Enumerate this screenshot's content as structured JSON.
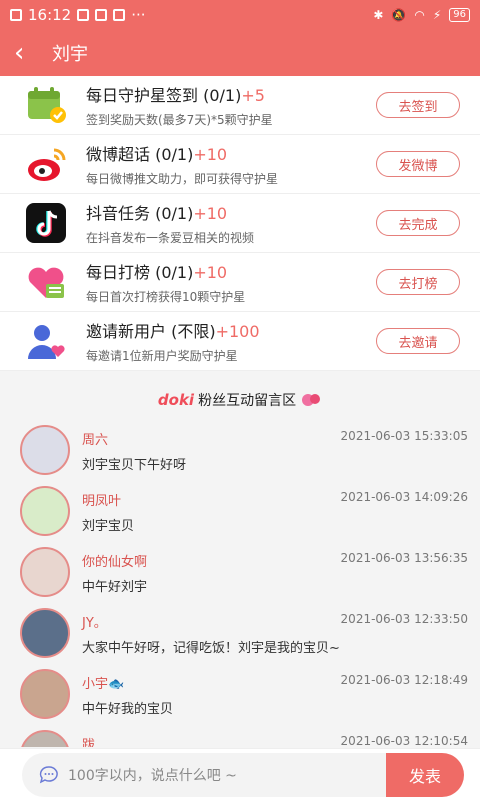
{
  "status_bar": {
    "time": "16:12",
    "battery": "96",
    "more": "···"
  },
  "nav": {
    "back": "‹",
    "title": "刘宇"
  },
  "tasks": [
    {
      "title": "每日守护星签到 (0/1)",
      "reward": "+5",
      "sub": "签到奖励天数(最多7天)*5颗守护星",
      "button": "去签到",
      "icon": "calendar-check-icon"
    },
    {
      "title": "微博超话 (0/1)",
      "reward": "+10",
      "sub": "每日微博推文助力，即可获得守护星",
      "button": "发微博",
      "icon": "weibo-icon"
    },
    {
      "title": "抖音任务 (0/1)",
      "reward": "+10",
      "sub": "在抖音发布一条爱豆相关的视频",
      "button": "去完成",
      "icon": "douyin-icon"
    },
    {
      "title": "每日打榜 (0/1)",
      "reward": "+10",
      "sub": "每日首次打榜获得10颗守护星",
      "button": "去打榜",
      "icon": "heart-chart-icon"
    },
    {
      "title": "邀请新用户 (不限)",
      "reward": "+100",
      "sub": "每邀请1位新用户奖励守护星",
      "button": "去邀请",
      "icon": "invite-user-icon"
    }
  ],
  "comments_header": {
    "brand": "doki",
    "title": "粉丝互动留言区"
  },
  "comments": [
    {
      "name": "周六",
      "time": "2021-06-03 15:33:05",
      "text": "刘宇宝贝下午好呀",
      "color": "#dcdde8"
    },
    {
      "name": "明凤叶",
      "time": "2021-06-03 14:09:26",
      "text": "刘宇宝贝",
      "color": "#d9ecc9"
    },
    {
      "name": "你的仙女啊",
      "time": "2021-06-03 13:56:35",
      "text": "中午好刘宇",
      "color": "#e8d6cf"
    },
    {
      "name": "JY。",
      "time": "2021-06-03 12:33:50",
      "text": "大家中午好呀，记得吃饭！刘宇是我的宝贝~",
      "color": "#5b6f8a"
    },
    {
      "name": "小宇🐟",
      "time": "2021-06-03 12:18:49",
      "text": "中午好我的宝贝",
      "color": "#c9a58f"
    },
    {
      "name": "跋",
      "time": "2021-06-03 12:10:54",
      "text": "",
      "color": "#bfb5ad"
    }
  ],
  "input": {
    "placeholder": "100字以内，说点什么吧 ~",
    "send": "发表"
  },
  "colors": {
    "accent": "#ef6b66",
    "reward": "#ef6b66"
  }
}
